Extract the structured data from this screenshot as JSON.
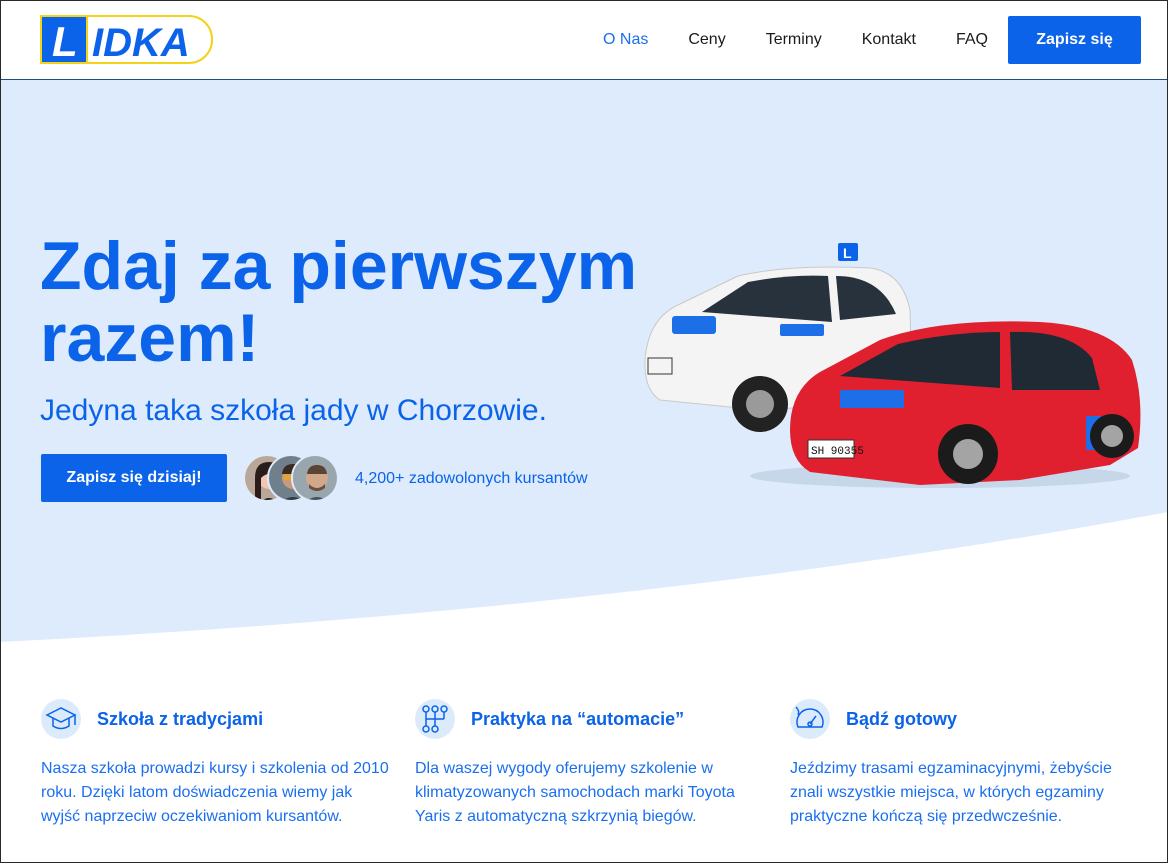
{
  "header": {
    "logo_text": "LIDKA",
    "nav": [
      "O Nas",
      "Ceny",
      "Terminy",
      "Kontakt",
      "FAQ"
    ],
    "cta": "Zapisz się"
  },
  "hero": {
    "title": "Zdaj za pierwszym razem!",
    "subtitle": "Jedyna taka szkoła jady w Chorzowie.",
    "cta": "Zapisz się dzisiaj!",
    "social_proof": "4,200+ zadowolonych kursantów",
    "car_plate_red": "SH 90355"
  },
  "features": [
    {
      "icon": "graduation-cap-icon",
      "title": "Szkoła z tradycjami",
      "text": "Nasza szkoła prowadzi kursy i szkolenia od 2010 roku. Dzięki latom doświadczenia wiemy jak wyjść naprzeciw oczekiwaniom kursantów."
    },
    {
      "icon": "gearbox-icon",
      "title": "Praktyka na “automacie”",
      "text": "Dla waszej wygody oferujemy szkolenie w klimatyzowanych samochodach marki Toyota Yaris z automatyczną szkrzynią biegów."
    },
    {
      "icon": "speedometer-icon",
      "title": "Bądź gotowy",
      "text": "Jeździmy trasami egzaminacyjnymi, żebyście znali wszystkie miejsca, w których egzaminy praktyczne kończą się przedwcześnie."
    }
  ],
  "colors": {
    "brand_blue": "#0b63ea",
    "hero_bg": "#ddebfc",
    "logo_yellow": "#f3d21a"
  }
}
